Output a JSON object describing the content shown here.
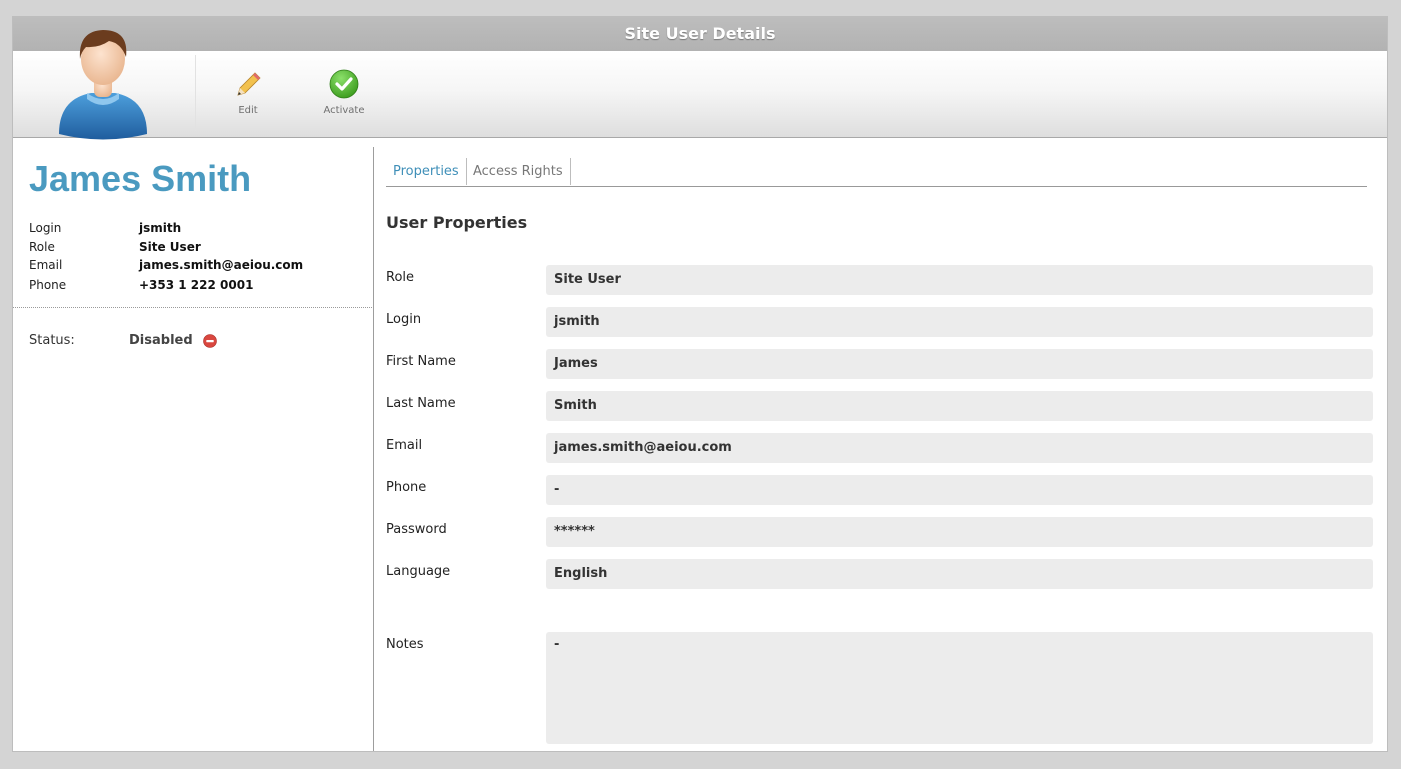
{
  "window": {
    "title": "Site User Details"
  },
  "toolbar": {
    "edit_label": "Edit",
    "activate_label": "Activate",
    "icons": {
      "avatar": "user-avatar-icon",
      "edit": "pencil-icon",
      "activate": "check-circle-icon"
    }
  },
  "user": {
    "name": "James Smith",
    "info": [
      {
        "label": "Login",
        "value": "jsmith"
      },
      {
        "label": "Role",
        "value": "Site User"
      },
      {
        "label": "Email",
        "value": "james.smith@aeiou.com"
      },
      {
        "label": "Phone",
        "value": "+353 1 222 0001"
      }
    ],
    "status_label": "Status:",
    "status_value": "Disabled",
    "status_icon": "disabled-icon"
  },
  "tabs": [
    {
      "label": "Properties",
      "active": true
    },
    {
      "label": "Access Rights",
      "active": false
    }
  ],
  "properties": {
    "title": "User Properties",
    "fields": [
      {
        "label": "Role",
        "value": "Site User"
      },
      {
        "label": "Login",
        "value": "jsmith"
      },
      {
        "label": "First Name",
        "value": "James"
      },
      {
        "label": "Last Name",
        "value": "Smith"
      },
      {
        "label": "Email",
        "value": "james.smith@aeiou.com"
      },
      {
        "label": "Phone",
        "value": "-"
      },
      {
        "label": "Password",
        "value": "******"
      },
      {
        "label": "Language",
        "value": "English"
      }
    ],
    "notes_label": "Notes",
    "notes_value": "-"
  },
  "colors": {
    "accent": "#4a9ac0",
    "titlebar": "#b6b6b6",
    "field_bg": "#ececec",
    "status_red": "#d9473f",
    "activate_green": "#4caf2a"
  }
}
